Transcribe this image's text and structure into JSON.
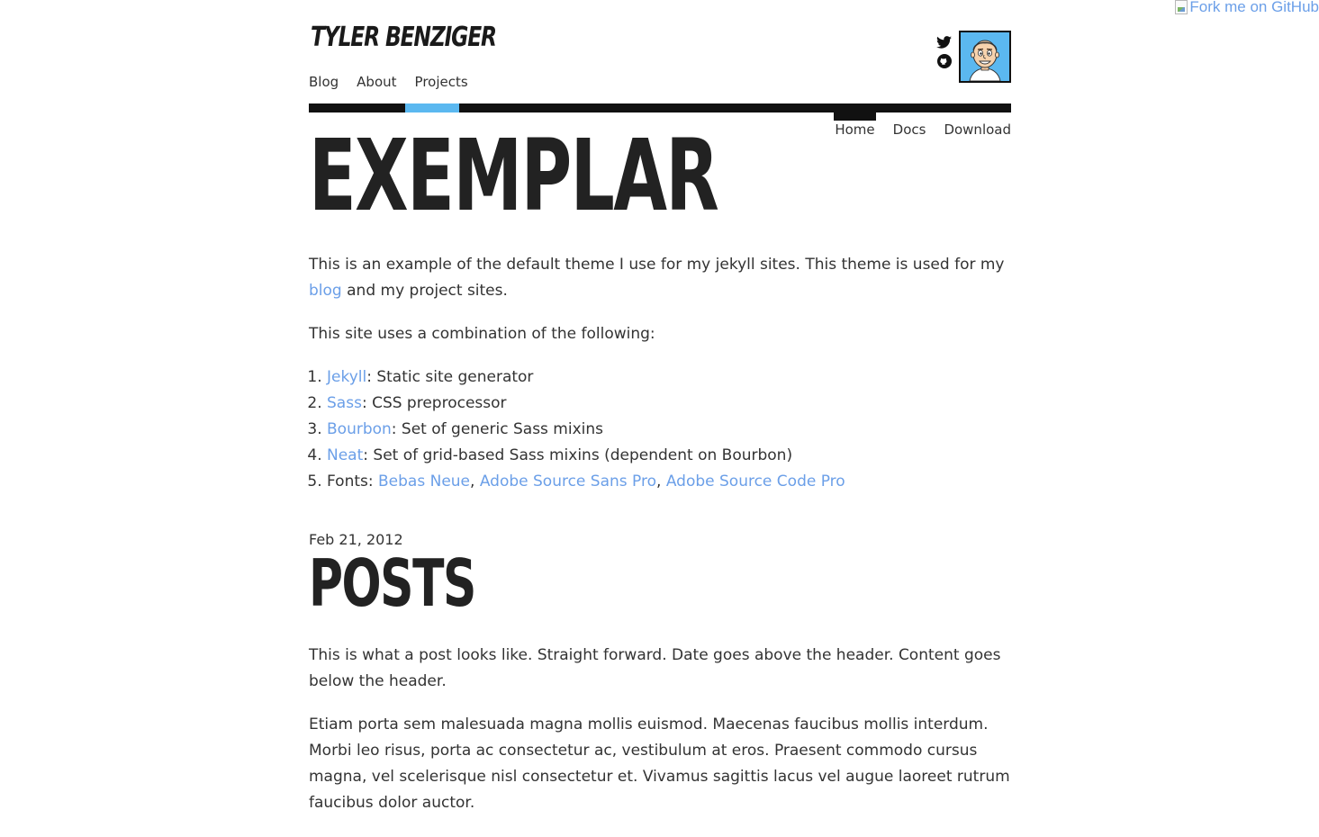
{
  "fork_banner": {
    "alt": "Fork me on GitHub"
  },
  "header": {
    "site_title": "TYLER BENZIGER",
    "nav": [
      "Blog",
      "About",
      "Projects"
    ],
    "social_icons": [
      "twitter-icon",
      "github-icon"
    ],
    "accent_color": "#5bb8f0"
  },
  "sub_nav": [
    "Home",
    "Docs",
    "Download"
  ],
  "page": {
    "title": "EXEMPLAR",
    "intro_before_link": "This is an example of the default theme I use for my jekyll sites. This theme is used for my ",
    "intro_link": "blog",
    "intro_after_link": " and my project sites.",
    "uses_text": "This site uses a combination of the following:",
    "list": [
      {
        "link": "Jekyll",
        "desc": ": Static site generator"
      },
      {
        "link": "Sass",
        "desc": ": CSS preprocessor"
      },
      {
        "link": "Bourbon",
        "desc": ": Set of generic Sass mixins"
      },
      {
        "link": "Neat",
        "desc": ": Set of grid-based Sass mixins (dependent on Bourbon)"
      }
    ],
    "fonts_label": "Fonts: ",
    "fonts": [
      "Bebas Neue",
      "Adobe Source Sans Pro",
      "Adobe Source Code Pro"
    ],
    "fonts_separator": ", "
  },
  "post": {
    "date": "Feb 21, 2012",
    "title": "POSTS",
    "paragraphs": [
      "This is what a post looks like. Straight forward. Date goes above the header. Content goes below the header.",
      "Etiam porta sem malesuada magna mollis euismod. Maecenas faucibus mollis interdum. Morbi leo risus, porta ac consectetur ac, vestibulum at eros. Praesent commodo cursus magna, vel scelerisque nisl consectetur et. Vivamus sagittis lacus vel augue laoreet rutrum faucibus dolor auctor."
    ]
  },
  "colors": {
    "link": "#6b9fe8",
    "text": "#333333",
    "heading": "#222222",
    "rule": "#111111"
  }
}
